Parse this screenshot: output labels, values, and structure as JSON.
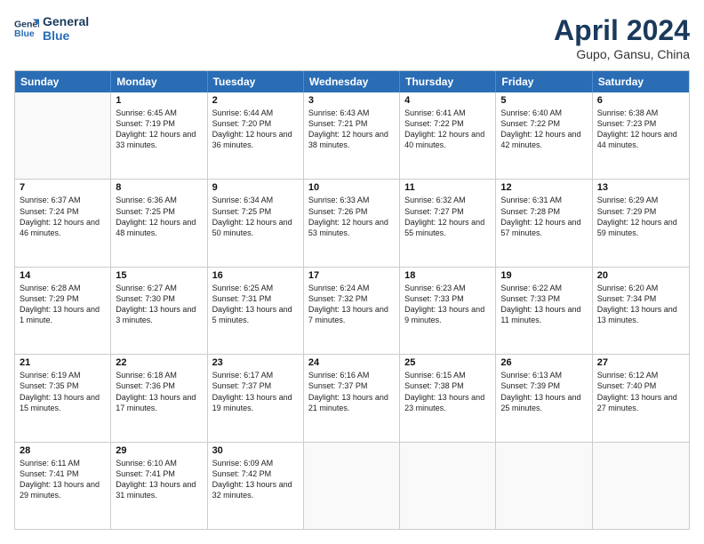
{
  "logo": {
    "line1": "General",
    "line2": "Blue"
  },
  "title": "April 2024",
  "location": "Gupo, Gansu, China",
  "days": [
    "Sunday",
    "Monday",
    "Tuesday",
    "Wednesday",
    "Thursday",
    "Friday",
    "Saturday"
  ],
  "weeks": [
    [
      {
        "num": "",
        "empty": true
      },
      {
        "num": "1",
        "sunrise": "Sunrise: 6:45 AM",
        "sunset": "Sunset: 7:19 PM",
        "daylight": "Daylight: 12 hours and 33 minutes."
      },
      {
        "num": "2",
        "sunrise": "Sunrise: 6:44 AM",
        "sunset": "Sunset: 7:20 PM",
        "daylight": "Daylight: 12 hours and 36 minutes."
      },
      {
        "num": "3",
        "sunrise": "Sunrise: 6:43 AM",
        "sunset": "Sunset: 7:21 PM",
        "daylight": "Daylight: 12 hours and 38 minutes."
      },
      {
        "num": "4",
        "sunrise": "Sunrise: 6:41 AM",
        "sunset": "Sunset: 7:22 PM",
        "daylight": "Daylight: 12 hours and 40 minutes."
      },
      {
        "num": "5",
        "sunrise": "Sunrise: 6:40 AM",
        "sunset": "Sunset: 7:22 PM",
        "daylight": "Daylight: 12 hours and 42 minutes."
      },
      {
        "num": "6",
        "sunrise": "Sunrise: 6:38 AM",
        "sunset": "Sunset: 7:23 PM",
        "daylight": "Daylight: 12 hours and 44 minutes."
      }
    ],
    [
      {
        "num": "7",
        "sunrise": "Sunrise: 6:37 AM",
        "sunset": "Sunset: 7:24 PM",
        "daylight": "Daylight: 12 hours and 46 minutes."
      },
      {
        "num": "8",
        "sunrise": "Sunrise: 6:36 AM",
        "sunset": "Sunset: 7:25 PM",
        "daylight": "Daylight: 12 hours and 48 minutes."
      },
      {
        "num": "9",
        "sunrise": "Sunrise: 6:34 AM",
        "sunset": "Sunset: 7:25 PM",
        "daylight": "Daylight: 12 hours and 50 minutes."
      },
      {
        "num": "10",
        "sunrise": "Sunrise: 6:33 AM",
        "sunset": "Sunset: 7:26 PM",
        "daylight": "Daylight: 12 hours and 53 minutes."
      },
      {
        "num": "11",
        "sunrise": "Sunrise: 6:32 AM",
        "sunset": "Sunset: 7:27 PM",
        "daylight": "Daylight: 12 hours and 55 minutes."
      },
      {
        "num": "12",
        "sunrise": "Sunrise: 6:31 AM",
        "sunset": "Sunset: 7:28 PM",
        "daylight": "Daylight: 12 hours and 57 minutes."
      },
      {
        "num": "13",
        "sunrise": "Sunrise: 6:29 AM",
        "sunset": "Sunset: 7:29 PM",
        "daylight": "Daylight: 12 hours and 59 minutes."
      }
    ],
    [
      {
        "num": "14",
        "sunrise": "Sunrise: 6:28 AM",
        "sunset": "Sunset: 7:29 PM",
        "daylight": "Daylight: 13 hours and 1 minute."
      },
      {
        "num": "15",
        "sunrise": "Sunrise: 6:27 AM",
        "sunset": "Sunset: 7:30 PM",
        "daylight": "Daylight: 13 hours and 3 minutes."
      },
      {
        "num": "16",
        "sunrise": "Sunrise: 6:25 AM",
        "sunset": "Sunset: 7:31 PM",
        "daylight": "Daylight: 13 hours and 5 minutes."
      },
      {
        "num": "17",
        "sunrise": "Sunrise: 6:24 AM",
        "sunset": "Sunset: 7:32 PM",
        "daylight": "Daylight: 13 hours and 7 minutes."
      },
      {
        "num": "18",
        "sunrise": "Sunrise: 6:23 AM",
        "sunset": "Sunset: 7:33 PM",
        "daylight": "Daylight: 13 hours and 9 minutes."
      },
      {
        "num": "19",
        "sunrise": "Sunrise: 6:22 AM",
        "sunset": "Sunset: 7:33 PM",
        "daylight": "Daylight: 13 hours and 11 minutes."
      },
      {
        "num": "20",
        "sunrise": "Sunrise: 6:20 AM",
        "sunset": "Sunset: 7:34 PM",
        "daylight": "Daylight: 13 hours and 13 minutes."
      }
    ],
    [
      {
        "num": "21",
        "sunrise": "Sunrise: 6:19 AM",
        "sunset": "Sunset: 7:35 PM",
        "daylight": "Daylight: 13 hours and 15 minutes."
      },
      {
        "num": "22",
        "sunrise": "Sunrise: 6:18 AM",
        "sunset": "Sunset: 7:36 PM",
        "daylight": "Daylight: 13 hours and 17 minutes."
      },
      {
        "num": "23",
        "sunrise": "Sunrise: 6:17 AM",
        "sunset": "Sunset: 7:37 PM",
        "daylight": "Daylight: 13 hours and 19 minutes."
      },
      {
        "num": "24",
        "sunrise": "Sunrise: 6:16 AM",
        "sunset": "Sunset: 7:37 PM",
        "daylight": "Daylight: 13 hours and 21 minutes."
      },
      {
        "num": "25",
        "sunrise": "Sunrise: 6:15 AM",
        "sunset": "Sunset: 7:38 PM",
        "daylight": "Daylight: 13 hours and 23 minutes."
      },
      {
        "num": "26",
        "sunrise": "Sunrise: 6:13 AM",
        "sunset": "Sunset: 7:39 PM",
        "daylight": "Daylight: 13 hours and 25 minutes."
      },
      {
        "num": "27",
        "sunrise": "Sunrise: 6:12 AM",
        "sunset": "Sunset: 7:40 PM",
        "daylight": "Daylight: 13 hours and 27 minutes."
      }
    ],
    [
      {
        "num": "28",
        "sunrise": "Sunrise: 6:11 AM",
        "sunset": "Sunset: 7:41 PM",
        "daylight": "Daylight: 13 hours and 29 minutes."
      },
      {
        "num": "29",
        "sunrise": "Sunrise: 6:10 AM",
        "sunset": "Sunset: 7:41 PM",
        "daylight": "Daylight: 13 hours and 31 minutes."
      },
      {
        "num": "30",
        "sunrise": "Sunrise: 6:09 AM",
        "sunset": "Sunset: 7:42 PM",
        "daylight": "Daylight: 13 hours and 32 minutes."
      },
      {
        "num": "",
        "empty": true
      },
      {
        "num": "",
        "empty": true
      },
      {
        "num": "",
        "empty": true
      },
      {
        "num": "",
        "empty": true
      }
    ]
  ]
}
